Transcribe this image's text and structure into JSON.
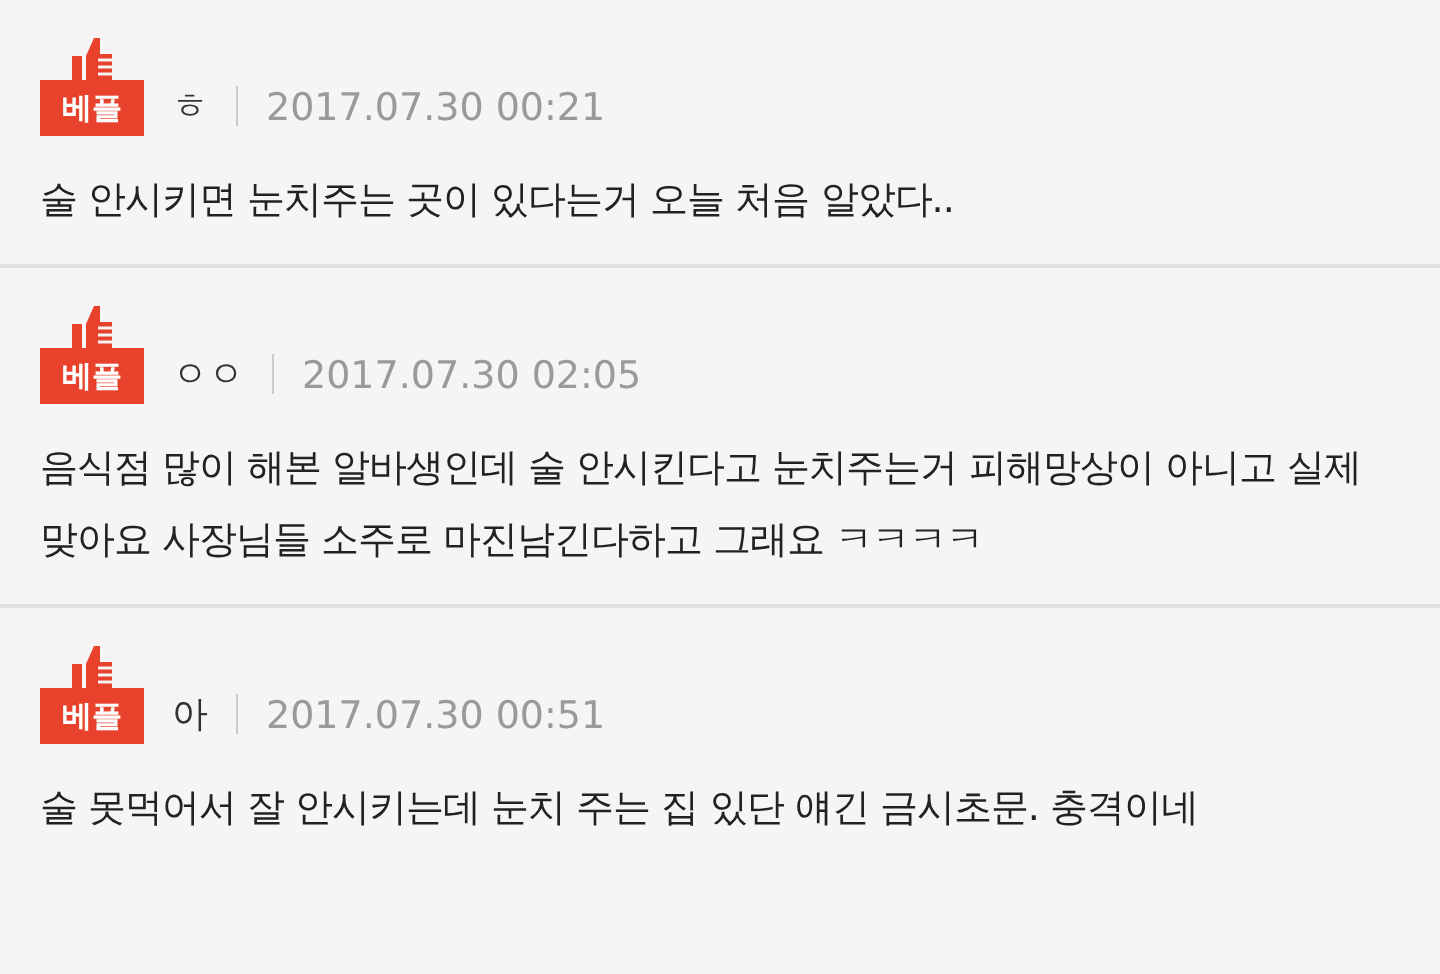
{
  "comments": [
    {
      "badge": "베플",
      "author": "ㅎ",
      "date": "2017.07.30 00:21",
      "text": "술 안시키면 눈치주는 곳이 있다는거 오늘 처음 알았다.."
    },
    {
      "badge": "베플",
      "author": "ㅇㅇ",
      "date": "2017.07.30 02:05",
      "text": "음식점 많이 해본 알바생인데 술 안시킨다고 눈치주는거 피해망상이 아니고 실제 맞아요 사장님들 소주로 마진남긴다하고 그래요 ㅋㅋㅋㅋ"
    },
    {
      "badge": "베플",
      "author": "아",
      "date": "2017.07.30 00:51",
      "text": "술 못먹어서 잘 안시키는데 눈치 주는 집 있단 얘긴 금시초문. 충격이네"
    }
  ]
}
